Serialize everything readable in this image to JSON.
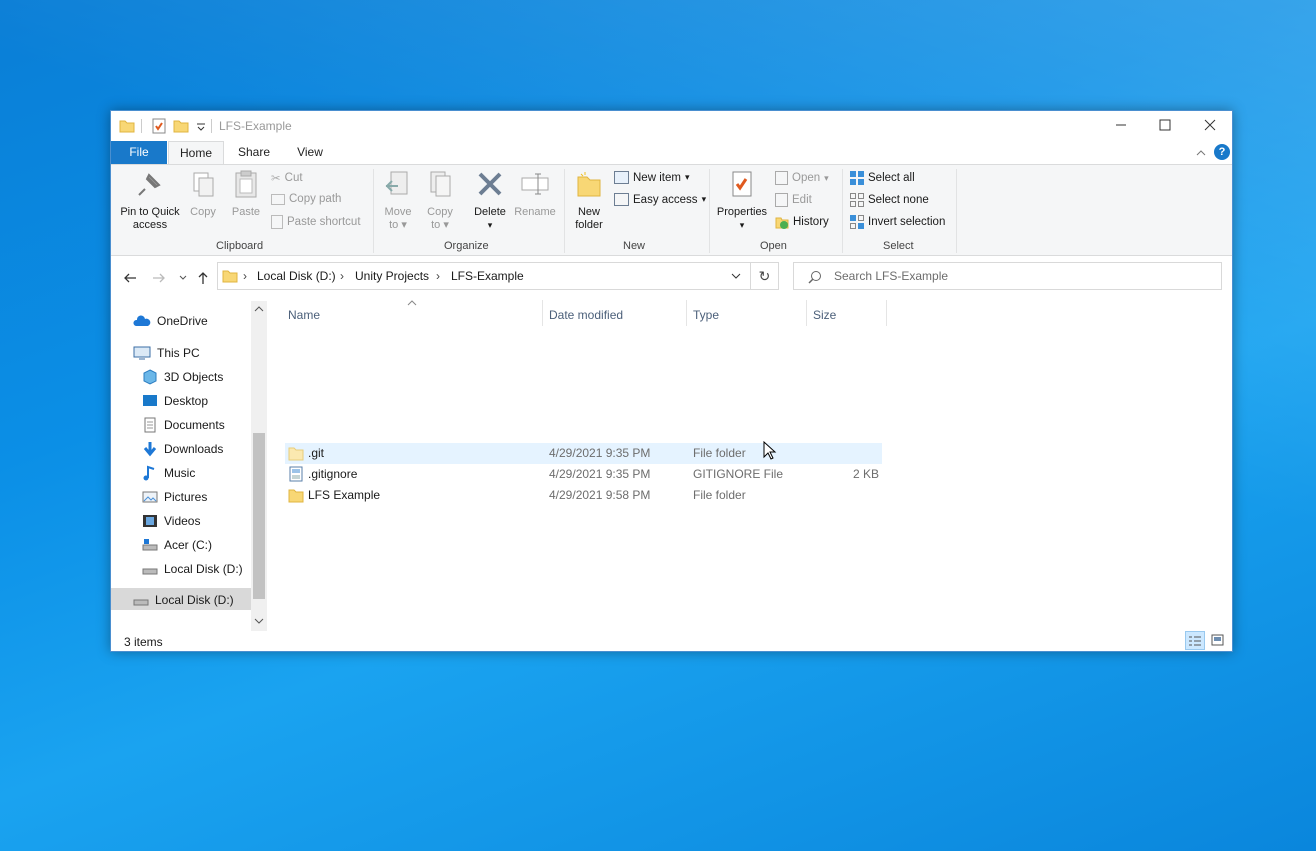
{
  "window": {
    "title": "LFS-Example"
  },
  "tabs": [
    "File",
    "Home",
    "Share",
    "View"
  ],
  "ribbon": {
    "clipboard": {
      "label": "Clipboard",
      "pin": "Pin to Quick access",
      "pin_l1": "Pin to Quick",
      "pin_l2": "access",
      "copy": "Copy",
      "paste": "Paste",
      "cut": "Cut",
      "copy_path": "Copy path",
      "paste_shortcut": "Paste shortcut"
    },
    "organize": {
      "label": "Organize",
      "move_l1": "Move",
      "move_l2": "to",
      "copy_l1": "Copy",
      "copy_l2": "to",
      "delete": "Delete",
      "rename": "Rename"
    },
    "new": {
      "label": "New",
      "new_folder_l1": "New",
      "new_folder_l2": "folder",
      "new_item": "New item",
      "easy_access": "Easy access"
    },
    "open": {
      "label": "Open",
      "properties": "Properties",
      "open": "Open",
      "edit": "Edit",
      "history": "History"
    },
    "select": {
      "label": "Select",
      "select_all": "Select all",
      "select_none": "Select none",
      "invert": "Invert selection"
    }
  },
  "address": {
    "crumbs": [
      "Local Disk (D:)",
      "Unity Projects",
      "LFS-Example"
    ],
    "search_placeholder": "Search LFS-Example"
  },
  "nav": [
    {
      "label": "OneDrive",
      "icon": "onedrive-icon"
    },
    {
      "label": "This PC",
      "icon": "this-pc-icon"
    },
    {
      "label": "3D Objects",
      "icon": "3d-objects-icon"
    },
    {
      "label": "Desktop",
      "icon": "desktop-icon"
    },
    {
      "label": "Documents",
      "icon": "documents-icon"
    },
    {
      "label": "Downloads",
      "icon": "downloads-icon"
    },
    {
      "label": "Music",
      "icon": "music-icon"
    },
    {
      "label": "Pictures",
      "icon": "pictures-icon"
    },
    {
      "label": "Videos",
      "icon": "videos-icon"
    },
    {
      "label": "Acer (C:)",
      "icon": "drive-c-icon"
    },
    {
      "label": "Local Disk (D:)",
      "icon": "drive-d-icon"
    },
    {
      "label": "Local Disk (D:)",
      "icon": "drive-d-icon"
    }
  ],
  "columns": {
    "name": "Name",
    "date": "Date modified",
    "type": "Type",
    "size": "Size"
  },
  "files": [
    {
      "name": ".git",
      "date": "4/29/2021 9:35 PM",
      "type": "File folder",
      "size": ""
    },
    {
      "name": ".gitignore",
      "date": "4/29/2021 9:35 PM",
      "type": "GITIGNORE File",
      "size": "2 KB"
    },
    {
      "name": "LFS Example",
      "date": "4/29/2021 9:58 PM",
      "type": "File folder",
      "size": ""
    }
  ],
  "status": {
    "items": "3 items"
  }
}
